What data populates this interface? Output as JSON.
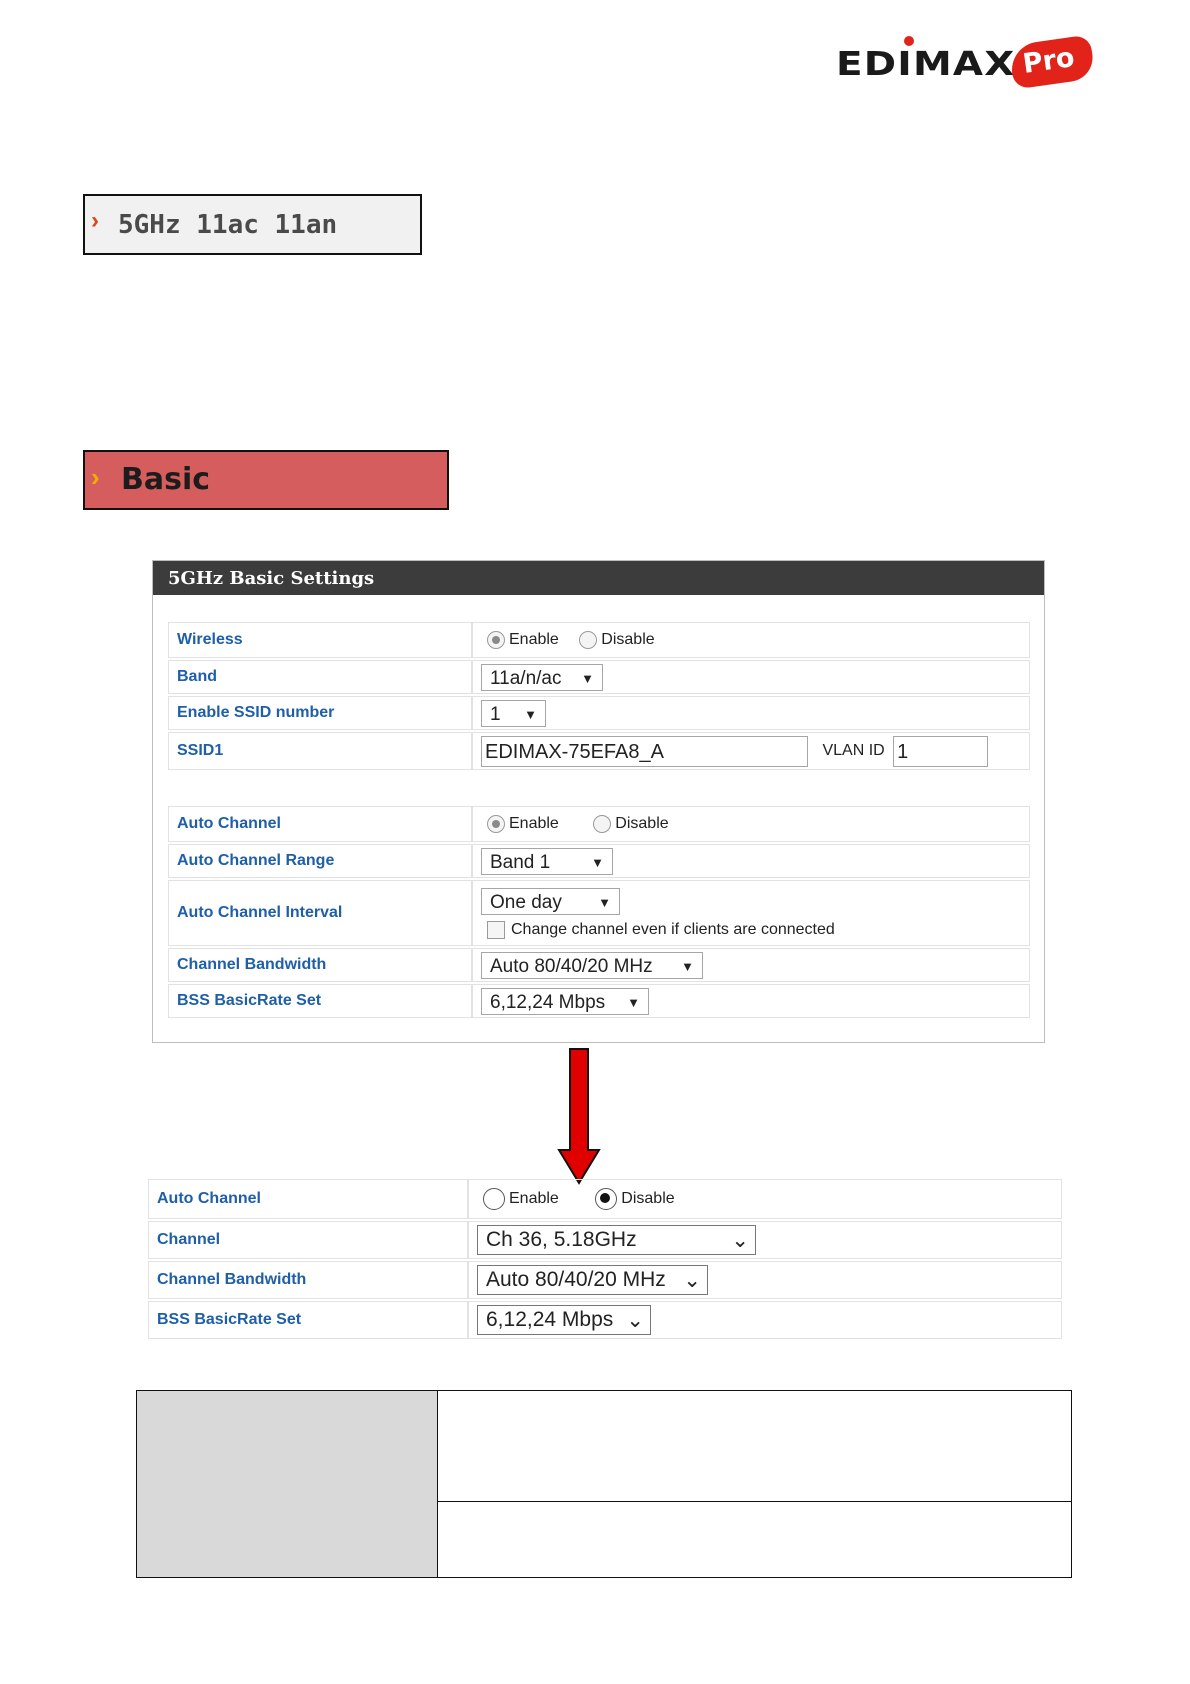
{
  "logo": {
    "brand": "EDIMAX",
    "badge": "Pro"
  },
  "section_5ghz": {
    "label": "5GHz 11ac 11an"
  },
  "section_basic": {
    "label": "Basic"
  },
  "panel": {
    "title": "5GHz Basic Settings",
    "wireless": {
      "label": "Wireless",
      "enable": "Enable",
      "disable": "Disable",
      "selected": "Enable"
    },
    "band": {
      "label": "Band",
      "value": "11a/n/ac"
    },
    "ssid_number": {
      "label": "Enable SSID number",
      "value": "1"
    },
    "ssid1": {
      "label": "SSID1",
      "value": "EDIMAX-75EFA8_A",
      "vlan_label": "VLAN ID",
      "vlan_value": "1"
    },
    "auto_channel": {
      "label": "Auto Channel",
      "enable": "Enable",
      "disable": "Disable",
      "selected": "Enable"
    },
    "auto_channel_range": {
      "label": "Auto Channel Range",
      "value": "Band 1"
    },
    "auto_channel_interval": {
      "label": "Auto Channel Interval",
      "value": "One day",
      "checkbox_label": "Change channel even if clients are connected"
    },
    "channel_bandwidth": {
      "label": "Channel Bandwidth",
      "value": "Auto 80/40/20 MHz"
    },
    "bss_basic_rate_set": {
      "label": "BSS BasicRate Set",
      "value": "6,12,24 Mbps"
    }
  },
  "arrow_color": "#e00000",
  "disabled_view": {
    "auto_channel": {
      "label": "Auto Channel",
      "enable": "Enable",
      "disable": "Disable",
      "selected": "Disable"
    },
    "channel": {
      "label": "Channel",
      "value": "Ch 36, 5.18GHz"
    },
    "channel_bandwidth": {
      "label": "Channel Bandwidth",
      "value": "Auto 80/40/20 MHz"
    },
    "bss_basic_rate_set": {
      "label": "BSS BasicRate Set",
      "value": "6,12,24 Mbps"
    }
  },
  "colors": {
    "label_blue": "#1f5fa8",
    "basic_red": "#d65d5d",
    "panel_header": "#3c3c3c"
  }
}
